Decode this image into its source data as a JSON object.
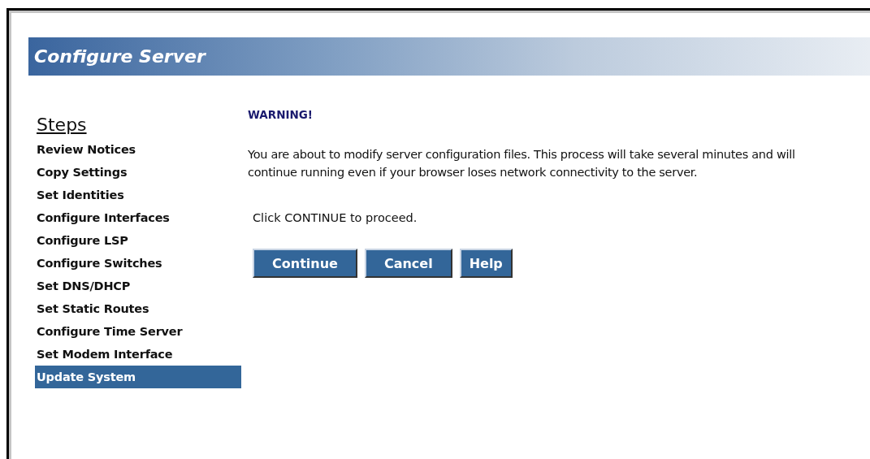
{
  "header": {
    "title": "Configure Server"
  },
  "sidebar": {
    "heading": "Steps",
    "items": [
      {
        "label": "Review Notices",
        "selected": false
      },
      {
        "label": "Copy Settings",
        "selected": false
      },
      {
        "label": "Set Identities",
        "selected": false
      },
      {
        "label": "Configure Interfaces",
        "selected": false
      },
      {
        "label": "Configure LSP",
        "selected": false
      },
      {
        "label": "Configure Switches",
        "selected": false
      },
      {
        "label": "Set DNS/DHCP",
        "selected": false
      },
      {
        "label": "Set Static Routes",
        "selected": false
      },
      {
        "label": "Configure Time Server",
        "selected": false
      },
      {
        "label": "Set Modem Interface",
        "selected": false
      },
      {
        "label": "Update System",
        "selected": true
      }
    ]
  },
  "content": {
    "warning": "WARNING!",
    "message": "You are about to modify server configuration files. This process will take several minutes and will continue running even if your browser loses network connectivity to the server.",
    "instruction": "Click CONTINUE to proceed.",
    "buttons": [
      "Continue",
      "Cancel",
      "Help"
    ]
  }
}
